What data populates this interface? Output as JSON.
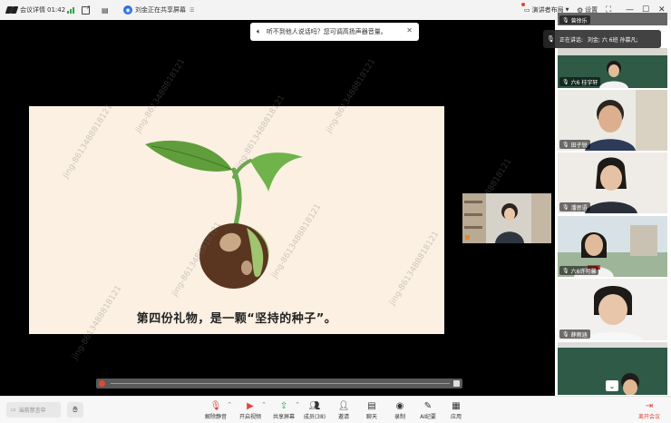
{
  "topbar": {
    "meeting_details_label": "会议详情",
    "duration": "01:42",
    "sharing_status": "刘金正在共享屏幕",
    "layout_label": "演讲者布局",
    "settings_label": "设置"
  },
  "notice": {
    "text": "听不到他人说话吗？您可调高扬声器音量。"
  },
  "slide": {
    "caption": "第四份礼物，是一颗“坚持的种子”。",
    "watermark": "jing-8613488818121",
    "timestamp": "2025/04/27 07:32:04"
  },
  "speaking": {
    "label": "正在讲话:",
    "names": "刘金; 六 6班 孙慕凡;"
  },
  "participants": [
    {
      "name": "曾徐乐"
    },
    {
      "name": "六6 桂宇轩"
    },
    {
      "name": "田子锐"
    },
    {
      "name": "潘思语"
    },
    {
      "name": "六6许可馨"
    },
    {
      "name": "薛雨涵"
    }
  ],
  "toolbar": {
    "mute_all_placeholder": "当前禁言中",
    "unmute": "解除静音",
    "video": "开启视频",
    "share": "共享屏幕",
    "members": "成员(38)",
    "invite": "邀请",
    "chat": "聊天",
    "record": "录制",
    "ai_minutes": "AI纪要",
    "apps": "应用",
    "leave": "离开会议"
  },
  "colors": {
    "accent_blue": "#2e6fe6",
    "leave_red": "#e0463a",
    "signal_green": "#27a844",
    "slide_bg": "#fbf0e2",
    "seedling_green": "#6aa84f"
  }
}
